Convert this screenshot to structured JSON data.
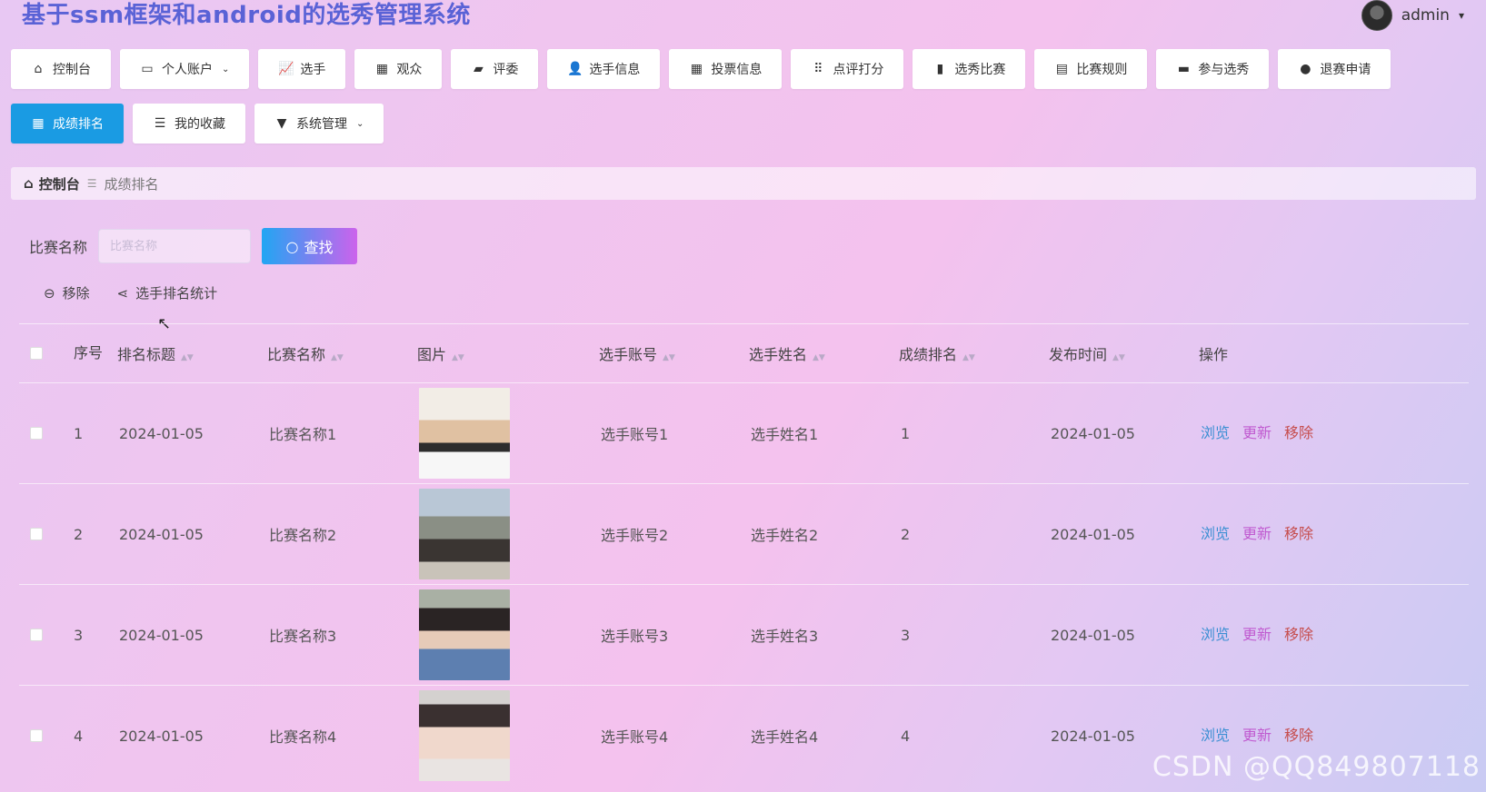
{
  "app": {
    "title": "基于ssm框架和android的选秀管理系统"
  },
  "user": {
    "name": "admin"
  },
  "nav": {
    "row1": [
      {
        "label": "控制台",
        "icon": "home-icon"
      },
      {
        "label": "个人账户",
        "icon": "card-icon",
        "dropdown": true
      },
      {
        "label": "选手",
        "icon": "chart-line-icon"
      },
      {
        "label": "观众",
        "icon": "grid-icon"
      },
      {
        "label": "评委",
        "icon": "wallet-icon"
      },
      {
        "label": "选手信息",
        "icon": "user-icon"
      },
      {
        "label": "投票信息",
        "icon": "grid-icon"
      },
      {
        "label": "点评打分",
        "icon": "dots-grid-icon"
      },
      {
        "label": "选秀比赛",
        "icon": "bar-chart-icon"
      },
      {
        "label": "比赛规则",
        "icon": "briefcase-icon"
      },
      {
        "label": "参与选秀",
        "icon": "inbox-icon"
      },
      {
        "label": "退赛申请",
        "icon": "bulb-icon"
      }
    ],
    "row2": [
      {
        "label": "成绩排名",
        "icon": "grid-icon",
        "active": true
      },
      {
        "label": "我的收藏",
        "icon": "sliders-icon"
      },
      {
        "label": "系统管理",
        "icon": "brush-icon",
        "dropdown": true
      }
    ]
  },
  "breadcrumb": {
    "home": "控制台",
    "current": "成绩排名"
  },
  "search": {
    "label": "比赛名称",
    "placeholder": "比赛名称",
    "value": "",
    "button": "查找"
  },
  "actions": {
    "remove": "移除",
    "stats": "选手排名统计"
  },
  "table": {
    "headers": {
      "index": "序号",
      "title": "排名标题",
      "contest": "比赛名称",
      "image": "图片",
      "account": "选手账号",
      "name": "选手姓名",
      "rank": "成绩排名",
      "time": "发布时间",
      "ops": "操作"
    },
    "rows": [
      {
        "index": "1",
        "title": "2024-01-05",
        "contest": "比赛名称1",
        "account": "选手账号1",
        "name": "选手姓名1",
        "rank": "1",
        "time": "2024-01-05"
      },
      {
        "index": "2",
        "title": "2024-01-05",
        "contest": "比赛名称2",
        "account": "选手账号2",
        "name": "选手姓名2",
        "rank": "2",
        "time": "2024-01-05"
      },
      {
        "index": "3",
        "title": "2024-01-05",
        "contest": "比赛名称3",
        "account": "选手账号3",
        "name": "选手姓名3",
        "rank": "3",
        "time": "2024-01-05"
      },
      {
        "index": "4",
        "title": "2024-01-05",
        "contest": "比赛名称4",
        "account": "选手账号4",
        "name": "选手姓名4",
        "rank": "4",
        "time": "2024-01-05"
      }
    ],
    "ops": {
      "view": "浏览",
      "update": "更新",
      "delete": "移除"
    }
  },
  "watermark": "CSDN @QQ849807118",
  "colors": {
    "active_tab": "#1a9be3",
    "view": "#3b8fd3",
    "update": "#c05ad0",
    "delete": "#c64d4d",
    "title": "#5a62d6"
  }
}
